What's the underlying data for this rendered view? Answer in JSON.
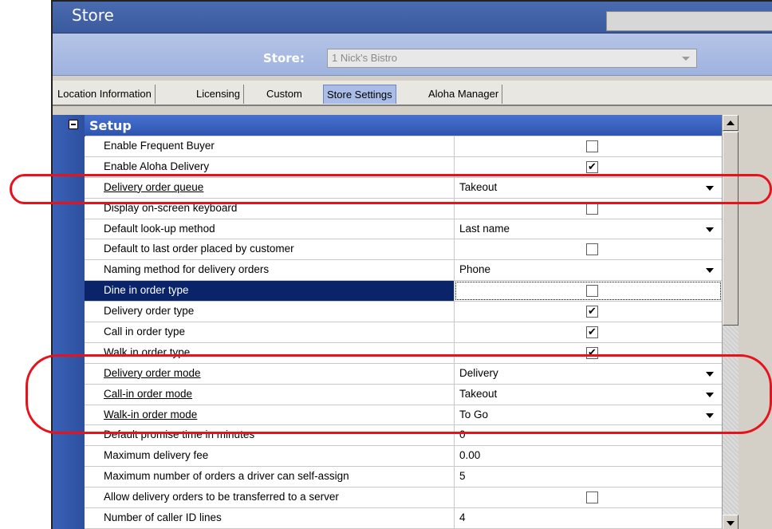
{
  "window": {
    "title": "Store"
  },
  "store_selector": {
    "label": "Store:",
    "value": "1 Nick's Bistro"
  },
  "tabs": [
    {
      "label": "Location Information",
      "active": false
    },
    {
      "label": "Licensing",
      "active": false
    },
    {
      "label": "Custom",
      "active": false
    },
    {
      "label": "Store Settings",
      "active": true
    },
    {
      "label": "Aloha Manager",
      "active": false
    }
  ],
  "section": {
    "title": "Setup",
    "collapse_icon": "minus-box-icon"
  },
  "rows": [
    {
      "label": "Enable Frequent Buyer",
      "type": "checkbox",
      "checked": false
    },
    {
      "label": "Enable Aloha Delivery",
      "type": "checkbox",
      "checked": true
    },
    {
      "label": "Delivery order queue",
      "type": "dropdown",
      "value": "Takeout"
    },
    {
      "label": "Display on-screen keyboard",
      "type": "checkbox",
      "checked": false
    },
    {
      "label": "Default look-up method",
      "type": "dropdown",
      "value": "Last name"
    },
    {
      "label": "Default to last order placed by customer",
      "type": "checkbox",
      "checked": false
    },
    {
      "label": "Naming method for delivery orders",
      "type": "dropdown",
      "value": "Phone"
    },
    {
      "label": "Dine in order type",
      "type": "checkbox",
      "checked": false,
      "selected": true
    },
    {
      "label": "Delivery order type",
      "type": "checkbox",
      "checked": true
    },
    {
      "label": "Call in order type",
      "type": "checkbox",
      "checked": true
    },
    {
      "label": "Walk in order type",
      "type": "checkbox",
      "checked": true
    },
    {
      "label": "Delivery order mode",
      "type": "dropdown",
      "value": "Delivery"
    },
    {
      "label": "Call-in order mode",
      "type": "dropdown",
      "value": "Takeout"
    },
    {
      "label": "Walk-in order mode",
      "type": "dropdown",
      "value": "To Go"
    },
    {
      "label": "Default promise time in minutes",
      "type": "text",
      "value": "0"
    },
    {
      "label": "Maximum delivery fee",
      "type": "text",
      "value": "0.00"
    },
    {
      "label": "Maximum number of orders a driver can self-assign",
      "type": "text",
      "value": "5"
    },
    {
      "label": "Allow delivery orders to be transferred to a server",
      "type": "checkbox",
      "checked": false
    },
    {
      "label": "Number of caller ID lines",
      "type": "text",
      "value": "4"
    }
  ],
  "colors": {
    "highlight_oval": "#e8121b",
    "selected_row": "#0a246a",
    "title_bar": "#3b5a9e"
  }
}
